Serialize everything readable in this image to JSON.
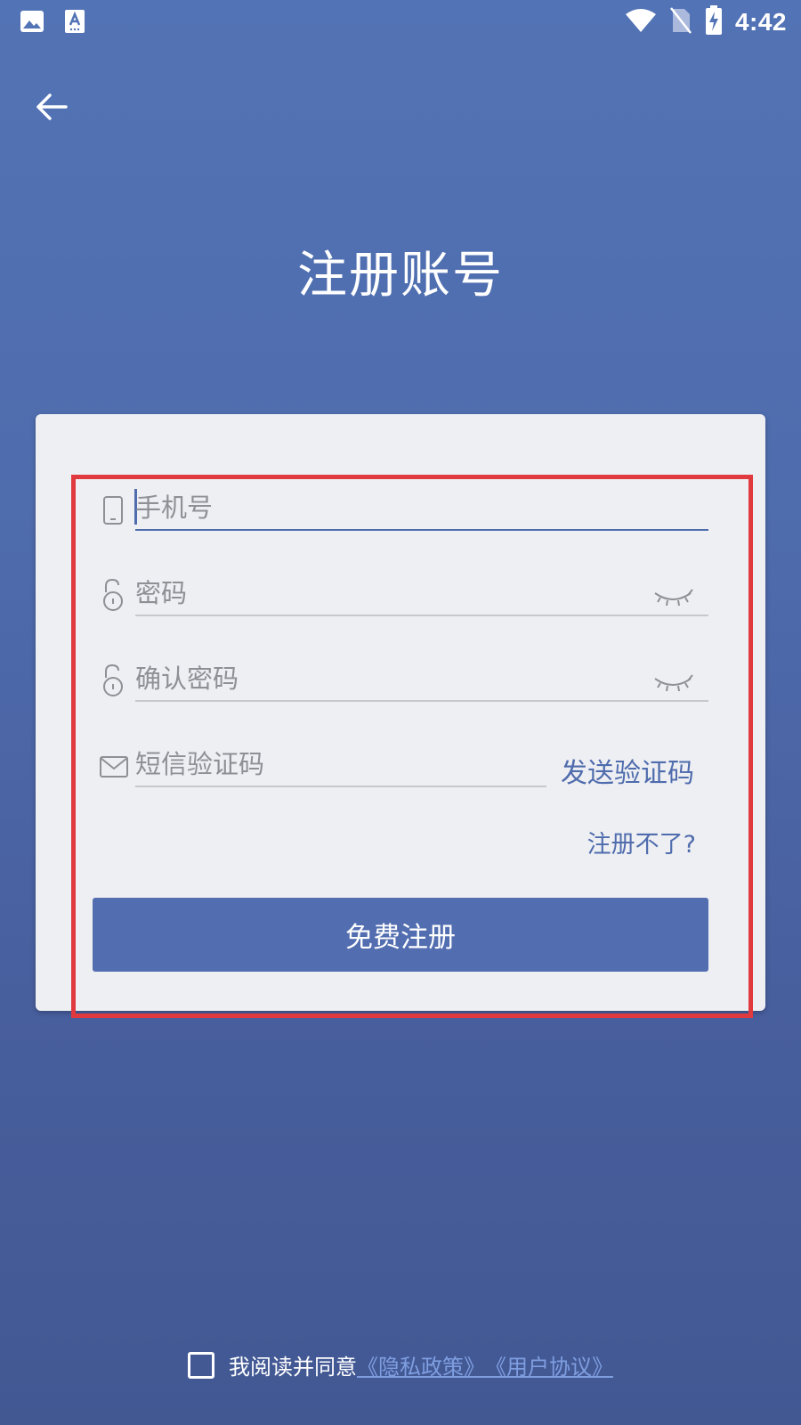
{
  "status_bar": {
    "time": "4:42",
    "left_icons": [
      "image-icon",
      "keyboard-a-icon"
    ],
    "right_icons": [
      "wifi-icon",
      "no-sim-icon",
      "battery-charging-icon"
    ]
  },
  "header": {
    "back_icon": "arrow-left-icon",
    "title": "注册账号"
  },
  "form": {
    "phone": {
      "icon": "phone-icon",
      "placeholder": "手机号",
      "value": ""
    },
    "password": {
      "icon": "unlock-icon",
      "placeholder": "密码",
      "value": "",
      "toggle_icon": "eye-closed-icon"
    },
    "confirm_password": {
      "icon": "unlock-icon",
      "placeholder": "确认密码",
      "value": "",
      "toggle_icon": "eye-closed-icon"
    },
    "sms_code": {
      "icon": "mail-icon",
      "placeholder": "短信验证码",
      "value": ""
    },
    "send_code_label": "发送验证码",
    "cant_register_label": "注册不了?",
    "register_button_label": "免费注册"
  },
  "agreement": {
    "text": "我阅读并同意",
    "privacy_link": "《隐私政策》",
    "user_agreement_link": "《用户协议》",
    "checked": false
  },
  "colors": {
    "background": "#4f6cad",
    "card": "#eeeff3",
    "accent": "#4f6cad",
    "highlight": "#e0393e",
    "link": "#7f9ee0"
  }
}
